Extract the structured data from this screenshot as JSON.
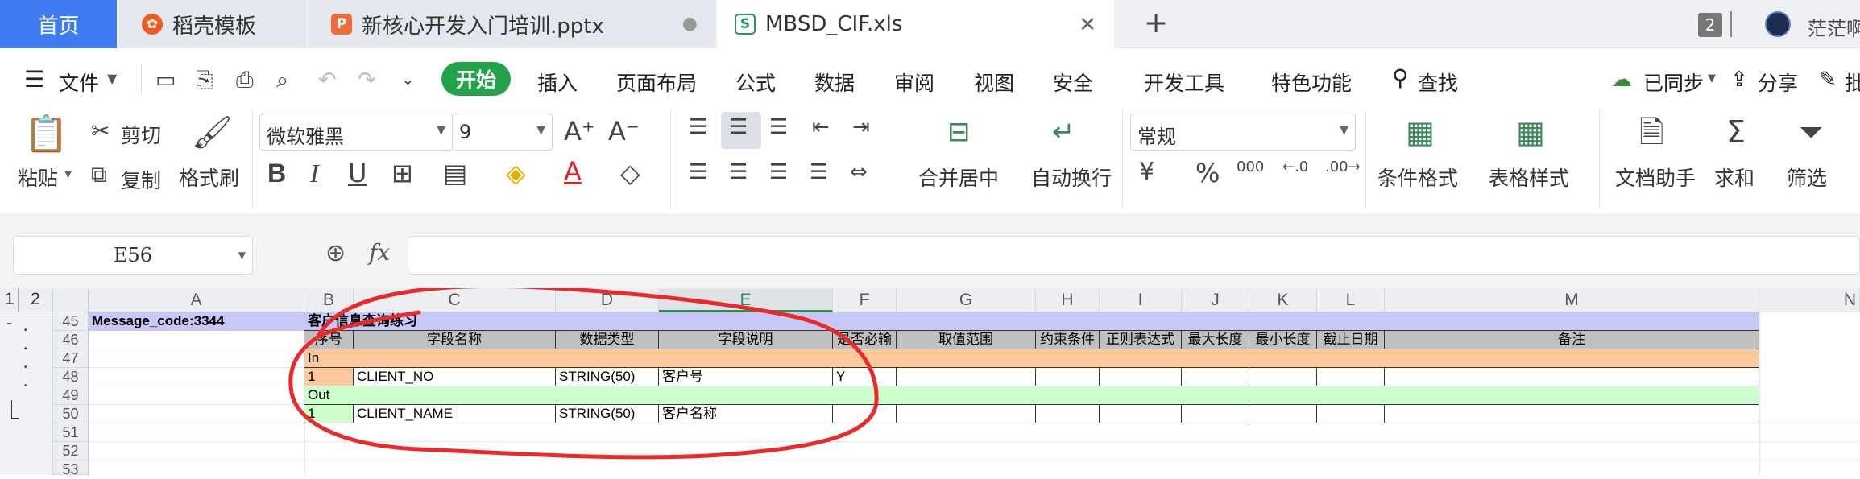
{
  "tabs": {
    "home": "首页",
    "tab1": "稻壳模板",
    "tab2": "新核心开发入门培训.pptx",
    "tab3": "MBSD_CIF.xls",
    "new": "+",
    "count": "2",
    "user": "茫茫啊"
  },
  "menu": {
    "file": "文件",
    "items": [
      "开始",
      "插入",
      "页面布局",
      "公式",
      "数据",
      "审阅",
      "视图",
      "安全",
      "开发工具",
      "特色功能"
    ],
    "search": "查找",
    "synced": "已同步",
    "share": "分享",
    "annotate": "批"
  },
  "ribbon": {
    "paste": "粘贴",
    "cut": "剪切",
    "copy": "复制",
    "format_painter": "格式刷",
    "font_name": "微软雅黑",
    "font_size": "9",
    "merge_center": "合并居中",
    "wrap_text": "自动换行",
    "number_format": "常规",
    "percent": "%",
    "thousands": "000",
    "conditional_format": "条件格式",
    "table_style": "表格样式",
    "doc_assistant": "文档助手",
    "sum": "求和",
    "filter": "筛选"
  },
  "formula_bar": {
    "name_box": "E56",
    "fx": "fx",
    "formula": ""
  },
  "grid": {
    "outline_levels": [
      "1",
      "2"
    ],
    "columns": [
      "A",
      "B",
      "C",
      "D",
      "E",
      "F",
      "G",
      "H",
      "I",
      "J",
      "K",
      "L",
      "M",
      "N"
    ],
    "rows": [
      "45",
      "46",
      "47",
      "48",
      "49",
      "50",
      "51",
      "52",
      "53"
    ],
    "a45": "Message_code:3344",
    "b45": "客户信息查询练习",
    "headers": [
      "序号",
      "字段名称",
      "数据类型",
      "字段说明",
      "是否必输",
      "取值范围",
      "约束条件",
      "正则表达式",
      "最大长度",
      "最小长度",
      "截止日期",
      "备注"
    ],
    "in_label": "In",
    "out_label": "Out",
    "row48": [
      "1",
      "CLIENT_NO",
      "STRING(50)",
      "客户号",
      "Y"
    ],
    "row50": [
      "1",
      "CLIENT_NAME",
      "STRING(50)",
      "客户名称",
      ""
    ]
  },
  "colors": {
    "accent": "#3f7bf2",
    "start_tab": "#22a34a",
    "title_row": "#c8c8f8",
    "header_row": "#c0c0c0",
    "in_row": "#fcc99b",
    "out_row": "#ccffcc",
    "annotation": "#e82a2a"
  }
}
